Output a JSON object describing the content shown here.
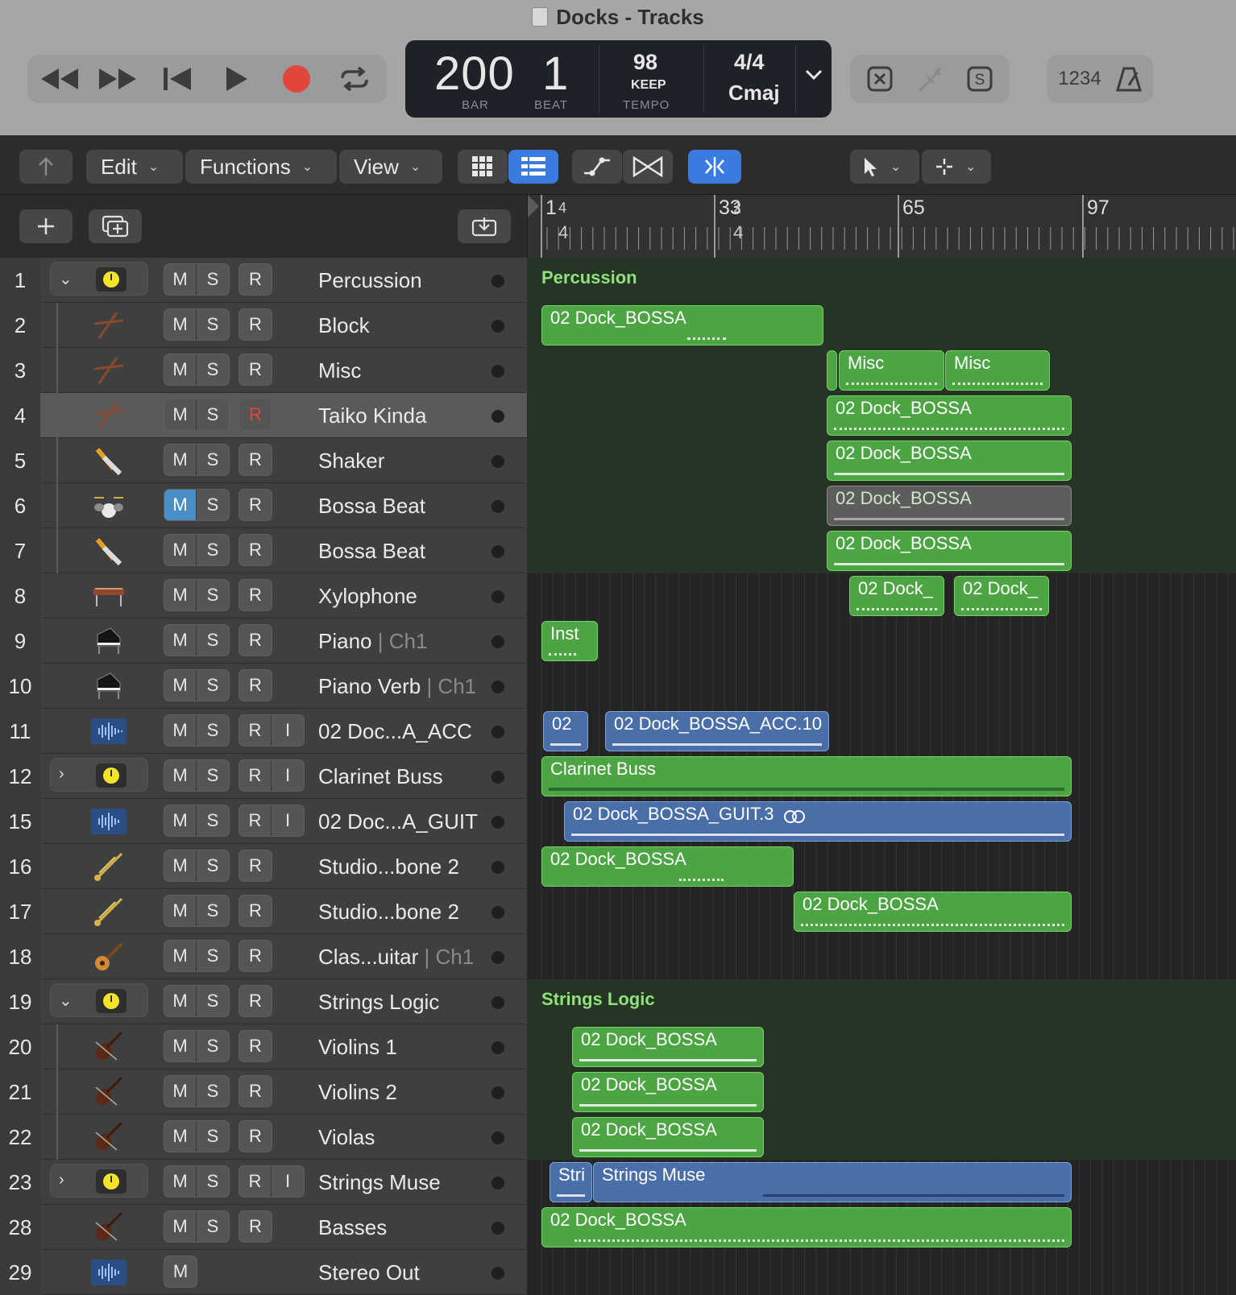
{
  "window": {
    "title": "Docks - Tracks"
  },
  "transport": {
    "bar": "200",
    "bar_label": "BAR",
    "beat": "1",
    "beat_label": "BEAT",
    "tempo": "98",
    "tempo_mode": "KEEP",
    "tempo_label": "TEMPO",
    "signature": "4/4",
    "key": "Cmaj",
    "count_in": "1234"
  },
  "toolbar": {
    "edit": "Edit",
    "functions": "Functions",
    "view": "View"
  },
  "ruler": {
    "marks": [
      "1",
      "33",
      "65",
      "97"
    ],
    "sub": [
      "4",
      "4"
    ],
    "alt": [
      "4",
      "2"
    ]
  },
  "tracks": [
    {
      "num": "1",
      "name": "Percussion",
      "icon": "summing-stack-icon"
    },
    {
      "num": "2",
      "name": "Block",
      "icon": "drumsticks-icon"
    },
    {
      "num": "3",
      "name": "Misc",
      "icon": "drumsticks-icon"
    },
    {
      "num": "4",
      "name": "Taiko Kinda",
      "icon": "drumsticks-icon"
    },
    {
      "num": "5",
      "name": "Shaker",
      "icon": "shaker-icon"
    },
    {
      "num": "6",
      "name": "Bossa Beat",
      "icon": "drum-kit-icon"
    },
    {
      "num": "7",
      "name": "Bossa Beat",
      "icon": "shaker-icon"
    },
    {
      "num": "8",
      "name": "Xylophone",
      "icon": "xylophone-icon"
    },
    {
      "num": "9",
      "name": "Piano",
      "channel": "Ch1",
      "icon": "piano-icon"
    },
    {
      "num": "10",
      "name": "Piano Verb",
      "channel": "Ch1",
      "icon": "piano-icon"
    },
    {
      "num": "11",
      "name": "02 Doc...A_ACC",
      "icon": "waveform-icon"
    },
    {
      "num": "12",
      "name": "Clarinet Buss",
      "icon": "summing-stack-icon"
    },
    {
      "num": "15",
      "name": "02 Doc...A_GUIT",
      "icon": "waveform-icon"
    },
    {
      "num": "16",
      "name": "Studio...bone 2",
      "icon": "trombone-icon"
    },
    {
      "num": "17",
      "name": "Studio...bone 2",
      "icon": "trombone-icon"
    },
    {
      "num": "18",
      "name": "Clas...uitar",
      "channel": "Ch1",
      "icon": "guitar-icon"
    },
    {
      "num": "19",
      "name": "Strings Logic",
      "icon": "summing-stack-icon"
    },
    {
      "num": "20",
      "name": "Violins 1",
      "icon": "violin-icon"
    },
    {
      "num": "21",
      "name": "Violins 2",
      "icon": "violin-icon"
    },
    {
      "num": "22",
      "name": "Violas",
      "icon": "violin-icon"
    },
    {
      "num": "23",
      "name": "Strings Muse",
      "icon": "summing-stack-icon"
    },
    {
      "num": "28",
      "name": "Basses",
      "icon": "violin-icon"
    },
    {
      "num": "29",
      "name": "Stereo Out",
      "icon": "waveform-icon"
    }
  ],
  "buttons": {
    "mute": "M",
    "solo": "S",
    "record": "R",
    "input": "I"
  },
  "regions": {
    "percussion_folder": "Percussion",
    "strings_folder": "Strings Logic",
    "dock": "02 Dock_BOSSA",
    "misc": "Misc",
    "dock_short": "02 Dock_",
    "inst": "Inst",
    "acc_short": "02",
    "acc": "02 Dock_BOSSA_ACC.10",
    "clarinet": "Clarinet Buss",
    "guit": "02 Dock_BOSSA_GUIT.3",
    "stri": "Stri",
    "strings_muse": "Strings Muse"
  },
  "colors": {
    "region_green": "#4ca442",
    "region_blue": "#4a6fa8",
    "record_red": "#e0463a",
    "accent_blue": "#3a7be0"
  }
}
